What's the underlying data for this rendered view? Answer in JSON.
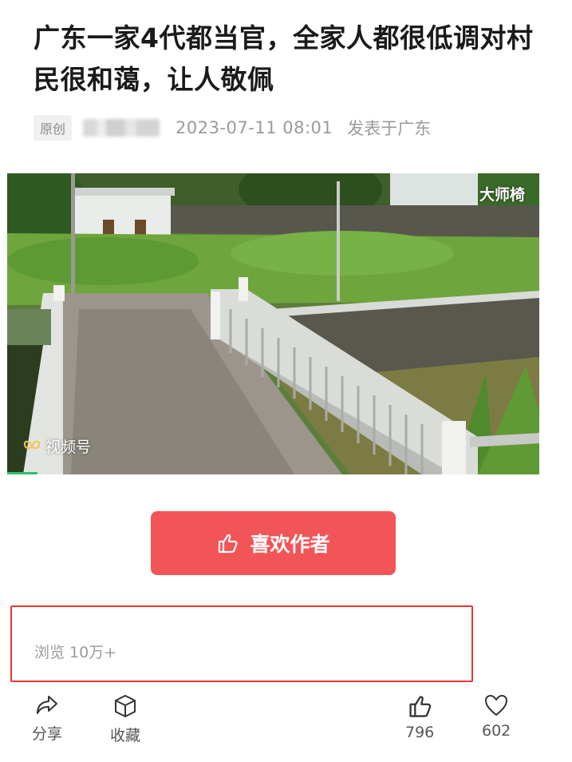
{
  "article": {
    "title": "广东一家4代都当官，全家人都很低调对村民很和蔼，让人敬佩",
    "badge": "原创",
    "date": "2023-07-11 08:01",
    "location": "发表于广东"
  },
  "video": {
    "watermark_top": "大师椅",
    "watermark_bottom": "视频号",
    "watermark_icon": "butterfly-icon"
  },
  "like_author": {
    "label": "喜欢作者",
    "icon": "thumbs-up-icon"
  },
  "stats": {
    "views": "浏览 10万+"
  },
  "actions": {
    "share": {
      "label": "分享",
      "icon": "share-icon"
    },
    "favorite": {
      "label": "收藏",
      "icon": "cube-icon"
    },
    "like": {
      "count": "796",
      "icon": "thumbs-up-icon"
    },
    "heart": {
      "count": "602",
      "icon": "heart-icon"
    }
  },
  "colors": {
    "accent": "#f25557",
    "highlight_border": "#e33333"
  }
}
